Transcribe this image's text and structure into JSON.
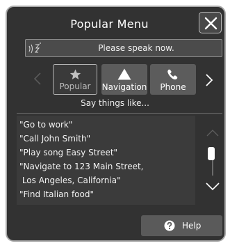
{
  "dialog": {
    "title": "Popular Menu",
    "speak_prompt": "Please speak now.",
    "hint": "Say things like...",
    "help_label": "Help"
  },
  "categories": [
    {
      "label": "Popular",
      "icon": "star-icon",
      "selected": true
    },
    {
      "label": "Navigation",
      "icon": "navigation-arrow-icon",
      "selected": false
    },
    {
      "label": "Phone",
      "icon": "phone-icon",
      "selected": false
    }
  ],
  "examples": [
    "\"Go to work\"",
    "\"Call John Smith\"",
    "\"Play song Easy Street\"",
    "\"Navigate to 123 Main Street,",
    " Los Angeles, California\"",
    "\"Find Italian food\""
  ],
  "colors": {
    "panel_background": "#323232",
    "button_background": "#5c5c5c",
    "text": "#ffffff"
  }
}
